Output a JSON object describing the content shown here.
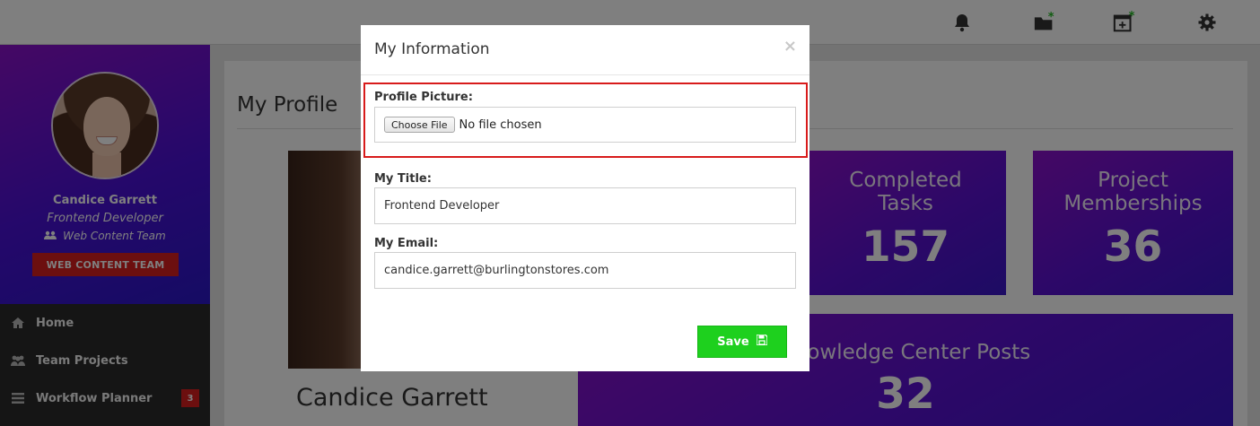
{
  "topbar": {
    "icons": [
      "bell-icon",
      "folder-add-icon",
      "calendar-add-icon",
      "gear-icon"
    ],
    "accent_color": "#22b922"
  },
  "sidebar": {
    "user_name": "Candice Garrett",
    "user_title": "Frontend Developer",
    "user_team": "Web Content Team",
    "team_button_label": "WEB CONTENT TEAM",
    "items": [
      {
        "label": "Home",
        "icon": "home-icon"
      },
      {
        "label": "Team Projects",
        "icon": "users-icon"
      },
      {
        "label": "Workflow Planner",
        "icon": "list-icon",
        "badge": "3"
      }
    ]
  },
  "main": {
    "page_title": "My Profile",
    "profile_name": "Candice Garrett",
    "stats": [
      {
        "label_line1": "Completed",
        "label_line2": "Tasks",
        "value": "157"
      },
      {
        "label_line1": "Project",
        "label_line2": "Memberships",
        "value": "36"
      },
      {
        "label": "Knowledge Center Posts",
        "value": "32"
      }
    ]
  },
  "modal": {
    "title": "My Information",
    "close_glyph": "×",
    "profile_picture_label": "Profile Picture:",
    "choose_file_label": "Choose File",
    "file_status": "No file chosen",
    "title_label": "My Title:",
    "title_value": "Frontend Developer",
    "email_label": "My Email:",
    "email_value": "candice.garrett@burlingtonstores.com",
    "save_label": "Save"
  },
  "colors": {
    "gradient_start": "#8a10c9",
    "gradient_end": "#2a17c8",
    "danger": "#d91f1f",
    "save_green": "#1ed01e",
    "highlight_red": "#d81b1b"
  }
}
